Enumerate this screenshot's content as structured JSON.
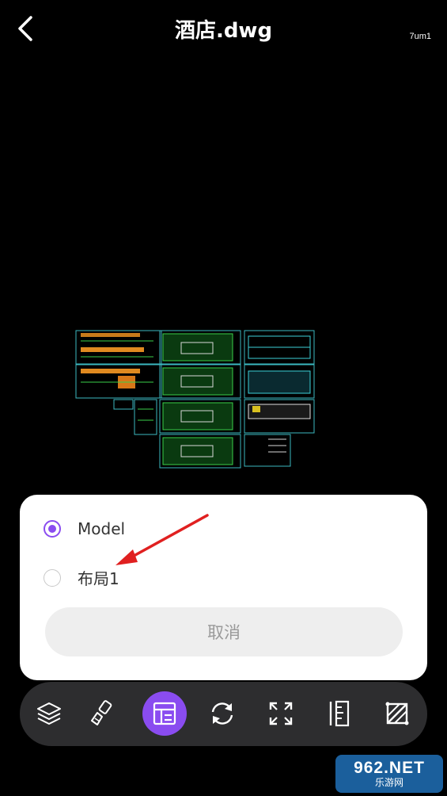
{
  "header": {
    "title": "酒店.dwg",
    "layout_tag": "7um1",
    "back_icon": "chevron-left-icon"
  },
  "layout_sheet": {
    "options": [
      {
        "label": "Model",
        "selected": true
      },
      {
        "label": "布局1",
        "selected": false
      }
    ],
    "cancel_label": "取消",
    "accent_color": "#8a4cf0"
  },
  "toolbar": {
    "tools": [
      {
        "icon": "layers-icon",
        "active": false
      },
      {
        "icon": "brush-icon",
        "active": false
      },
      {
        "icon": "layout-icon",
        "active": true
      },
      {
        "icon": "rotate-icon",
        "active": false
      },
      {
        "icon": "fullscreen-icon",
        "active": false
      },
      {
        "icon": "measure-icon",
        "active": false
      },
      {
        "icon": "crop-icon",
        "active": false
      }
    ]
  },
  "watermark": {
    "main": "962.NET",
    "sub": "乐游网"
  }
}
